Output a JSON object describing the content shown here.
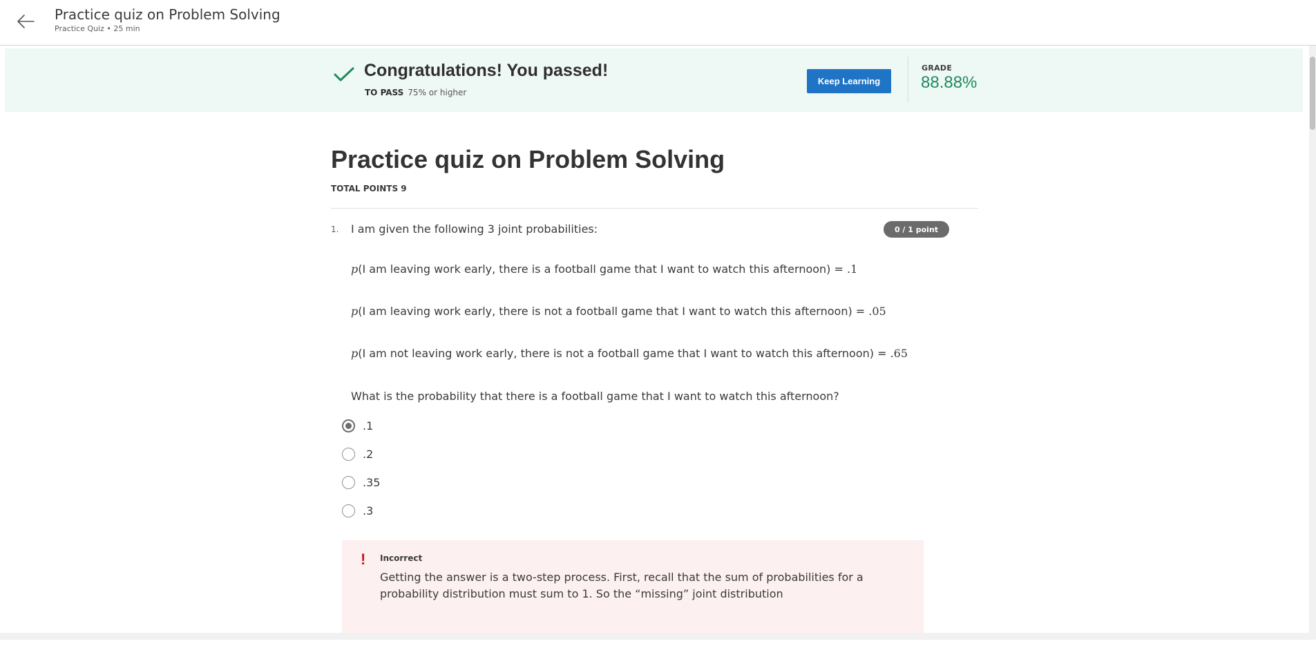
{
  "header": {
    "title": "Practice quiz on Problem Solving",
    "subtitle": "Practice Quiz • 25 min"
  },
  "banner": {
    "message": "Congratulations! You passed!",
    "to_pass_label": "TO PASS",
    "to_pass_value": "75% or higher",
    "keep_learning_label": "Keep Learning",
    "grade_label": "GRADE",
    "grade_value": "88.88%"
  },
  "quiz": {
    "title": "Practice quiz on Problem Solving",
    "total_points": "TOTAL POINTS 9"
  },
  "question1": {
    "number": "1.",
    "intro": "I am given the following 3 joint probabilities:",
    "points": "0 / 1 point",
    "probabilities": [
      {
        "symbol": "p",
        "text": "(I am leaving work early, there is a football game that I want to watch this afternoon) = ",
        "value": ".1"
      },
      {
        "symbol": "p",
        "text": "(I am leaving work early, there is not a football game that I want to watch this afternoon) = ",
        "value": ".05"
      },
      {
        "symbol": "p",
        "text": "(I am not leaving work early, there is not a football game that I want to watch this afternoon) = ",
        "value": ".65"
      }
    ],
    "question": "What is the probability that there is a football game that I want to watch this afternoon?",
    "options": [
      {
        "label": ".1",
        "selected": true
      },
      {
        "label": ".2",
        "selected": false
      },
      {
        "label": ".35",
        "selected": false
      },
      {
        "label": ".3",
        "selected": false
      }
    ],
    "feedback": {
      "status": "Incorrect",
      "text": "Getting the answer is a two-step process. First, recall that the sum of probabilities for a probability distribution must sum to 1. So the “missing” joint distribution"
    }
  },
  "colors": {
    "accent": "#1f74c6",
    "success": "#1f8a5e",
    "error": "#c4161c",
    "banner_bg": "#eef8f5",
    "feedback_bg": "#fdf0f0"
  },
  "icons": {
    "back": "arrow-left-icon",
    "passed": "check-icon",
    "incorrect": "exclamation-icon"
  }
}
